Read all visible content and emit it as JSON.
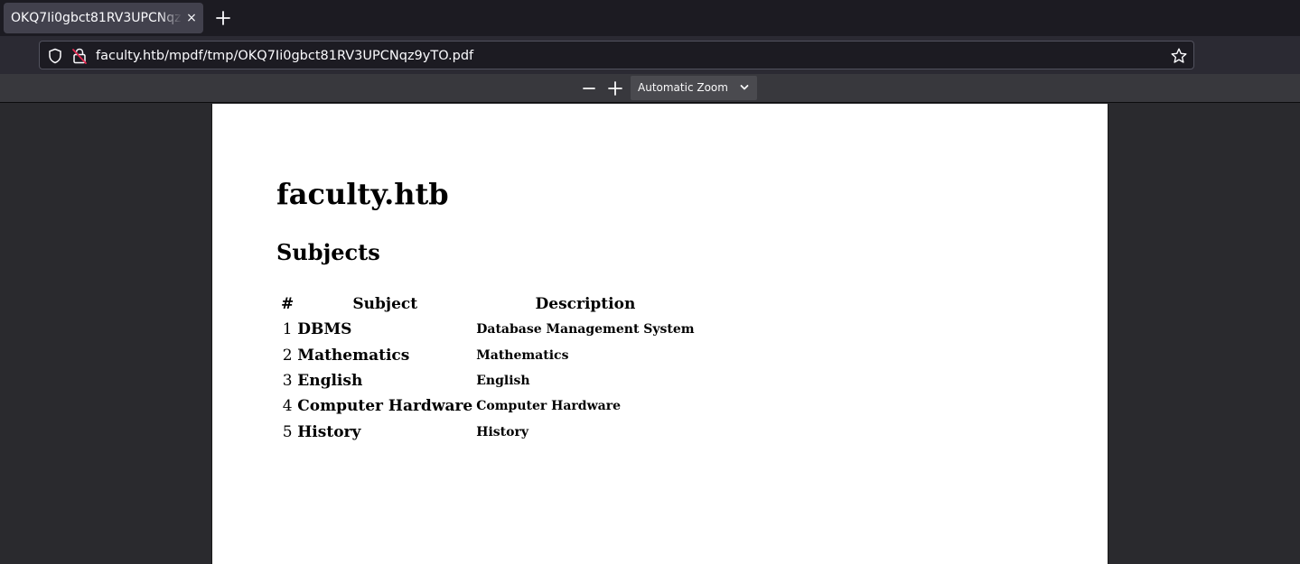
{
  "browser": {
    "tab": {
      "title": "OKQ7Ii0gbct81RV3UPCNqz9yTO.pdf",
      "close_glyph": "×"
    },
    "new_tab_icon": "plus-icon",
    "url": "faculty.htb/mpdf/tmp/OKQ7Ii0gbct81RV3UPCNqz9yTO.pdf"
  },
  "pdf_toolbar": {
    "zoom_out_icon": "minus-icon",
    "zoom_in_icon": "plus-icon",
    "zoom_value": "Automatic Zoom"
  },
  "document": {
    "title": "faculty.htb",
    "subtitle": "Subjects",
    "table": {
      "headers": [
        "#",
        "Subject",
        "Description"
      ],
      "rows": [
        {
          "num": "1",
          "subject": "DBMS",
          "description": "Database Management System"
        },
        {
          "num": "2",
          "subject": "Mathematics",
          "description": "Mathematics"
        },
        {
          "num": "3",
          "subject": "English",
          "description": "English"
        },
        {
          "num": "4",
          "subject": "Computer Hardware",
          "description": "Computer Hardware"
        },
        {
          "num": "5",
          "subject": "History",
          "description": "History"
        }
      ]
    }
  },
  "colors": {
    "tabstrip_bg": "#1c1b22",
    "navbar_bg": "#2b2a33",
    "toolbar_bg": "#38383d",
    "viewer_bg": "#2a2a2e",
    "page_bg": "#ffffff",
    "lock_slash": "#e22850"
  }
}
